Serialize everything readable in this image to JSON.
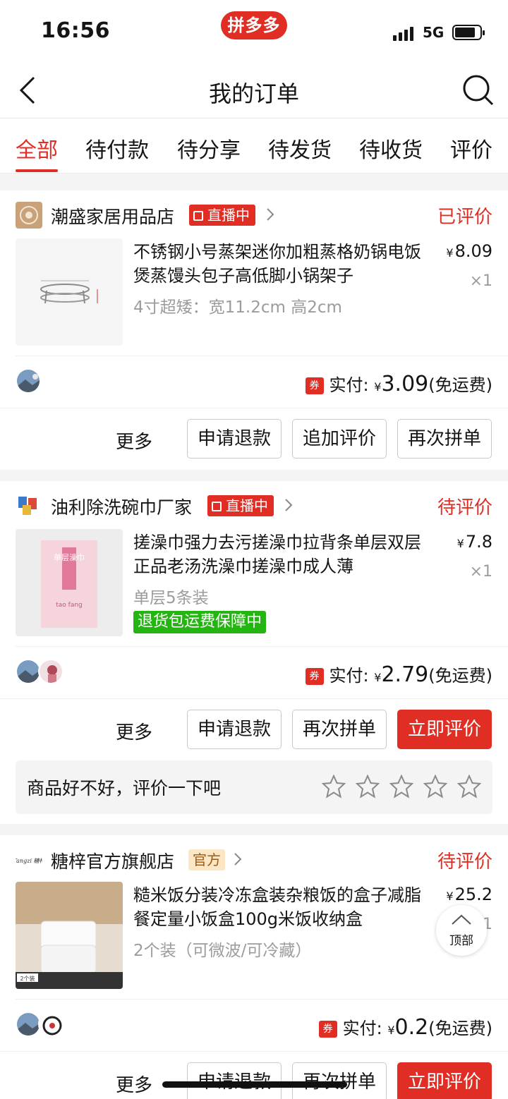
{
  "status_bar": {
    "time": "16:56",
    "app_logo": "拼多多",
    "network": "5G"
  },
  "nav": {
    "title": "我的订单",
    "back_icon": "chevron-left-icon",
    "search_icon": "search-icon"
  },
  "tabs": [
    "全部",
    "待付款",
    "待分享",
    "待发货",
    "待收货",
    "评价"
  ],
  "active_tab": "全部",
  "orders": [
    {
      "shop": "潮盛家居用品店",
      "badge": "直播中",
      "status": "已评价",
      "product_title": "不锈钢小号蒸架迷你加粗蒸格奶锅电饭煲蒸馒头包子高低脚小锅架子",
      "spec": "4寸超矮：宽11.2cm 高2cm",
      "price": "8.09",
      "qty": "×1",
      "pay_label": "实付:",
      "pay_amount": "3.09",
      "shipping": "(免运费)",
      "coupon": "券",
      "more": "更多",
      "buttons": [
        "申请退款",
        "追加评价",
        "再次拼单"
      ]
    },
    {
      "shop": "油利除洗碗巾厂家",
      "badge": "直播中",
      "status": "待评价",
      "product_title": "搓澡巾强力去污搓澡巾拉背条单层双层正品老汤洗澡巾搓澡巾成人薄",
      "spec": "单层5条装",
      "guarantee": "退货包运费保障中",
      "price": "7.8",
      "qty": "×1",
      "pay_label": "实付:",
      "pay_amount": "2.79",
      "shipping": "(免运费)",
      "coupon": "券",
      "more": "更多",
      "buttons": [
        "申请退款",
        "再次拼单",
        "立即评价"
      ],
      "rate_prompt": "商品好不好，评价一下吧",
      "rate_stars": 5
    },
    {
      "shop": "糖梓官方旗舰店",
      "badge": "官方",
      "status": "待评价",
      "product_title": "糙米饭分装冷冻盒装杂粮饭的盒子减脂餐定量小饭盒100g米饭收纳盒",
      "spec": "2个装（可微波/可冷藏）",
      "price": "25.2",
      "qty": "1",
      "pay_label": "实付:",
      "pay_amount": "0.2",
      "shipping": "(免运费)",
      "coupon": "券",
      "more": "更多",
      "buttons": [
        "申请退款",
        "再次拼单",
        "立即评价"
      ]
    }
  ],
  "currency_symbol": "¥",
  "back_to_top": "顶部",
  "product_image_text": {
    "order2_pack": "单层澡巾",
    "order2_brand": "tao fang",
    "order3_pack": "2个装",
    "order3_logo": "Tangzi 糖梓"
  },
  "colors": {
    "brand_red": "#e02e24",
    "guarantee_green": "#25b513",
    "official_badge_bg": "#fbe7c5"
  }
}
